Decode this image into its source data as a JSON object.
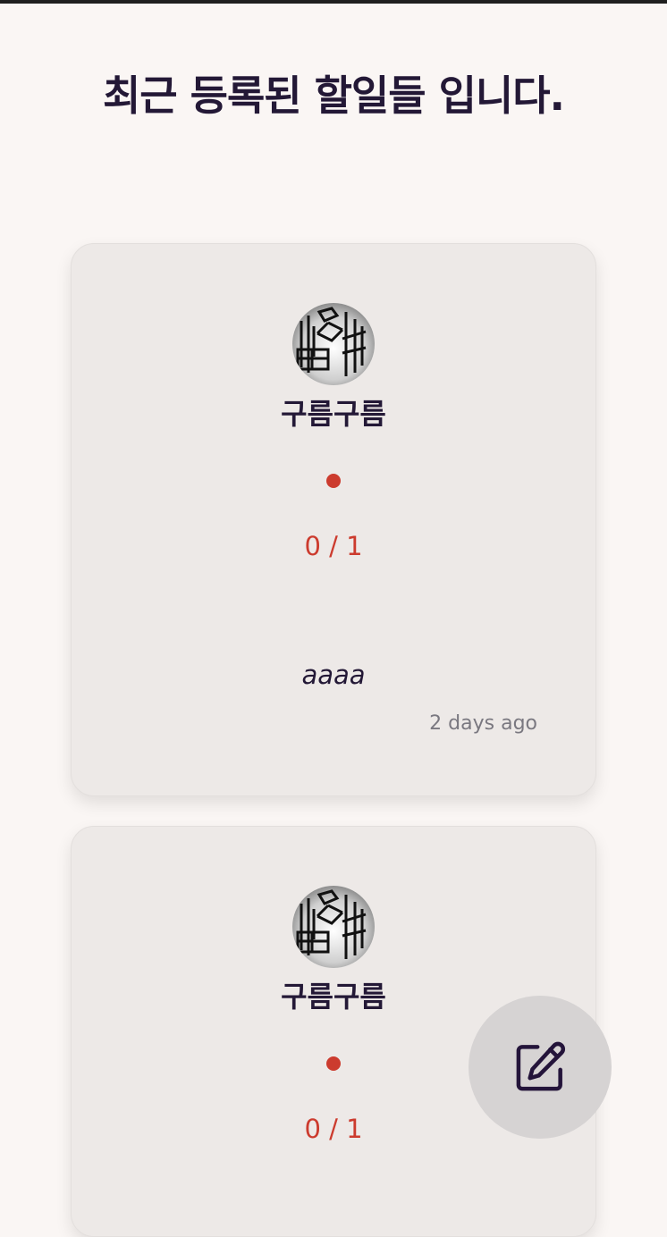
{
  "page": {
    "title": "최근 등록된 할일들 입니다."
  },
  "cards": [
    {
      "username": "구름구름",
      "progress": "0 / 1",
      "todo": "aaaa",
      "time_ago": "2 days ago",
      "status_color": "#cc3b2e"
    },
    {
      "username": "구름구름",
      "progress": "0 / 1",
      "status_color": "#cc3b2e"
    }
  ],
  "fab": {
    "icon": "edit-icon"
  },
  "colors": {
    "background": "#faf6f4",
    "card": "#ede9e7",
    "title": "#231836",
    "accent_red": "#cc3b2e",
    "fab": "#d6d3d3"
  }
}
